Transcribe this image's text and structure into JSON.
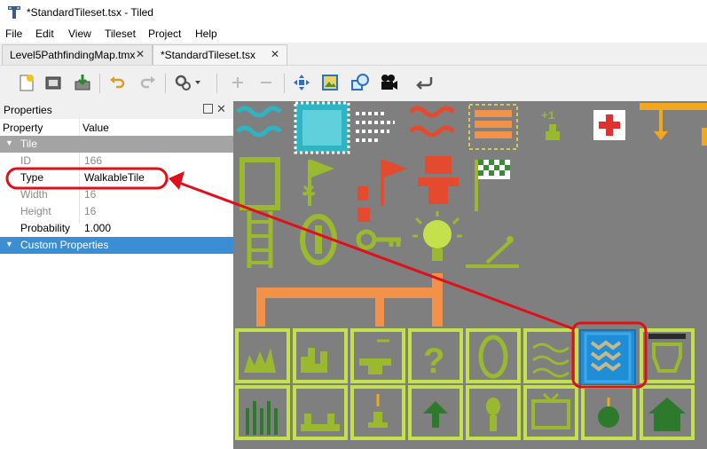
{
  "window": {
    "title": "*StandardTileset.tsx - Tiled"
  },
  "menu": [
    "File",
    "Edit",
    "View",
    "Tileset",
    "Project",
    "Help"
  ],
  "tabs": [
    {
      "label": "Level5PathfindingMap.tmx",
      "close": "✕"
    },
    {
      "label": "*StandardTileset.tsx",
      "close": "✕"
    }
  ],
  "toolbar": {
    "icons": [
      "new-file-icon",
      "open-icon",
      "save-icon",
      "undo-icon",
      "redo-icon",
      "settings-icon",
      "add-icon",
      "remove-icon",
      "move-icon",
      "image-icon",
      "shape-icon",
      "camera-icon",
      "back-arrow-icon"
    ]
  },
  "properties": {
    "title": "Properties",
    "close": "✕",
    "header": {
      "property": "Property",
      "value": "Value"
    },
    "group_tile": "Tile",
    "rows": [
      {
        "key": "ID",
        "value": "166"
      },
      {
        "key": "Type",
        "value": "WalkableTile"
      },
      {
        "key": "Width",
        "value": "16"
      },
      {
        "key": "Height",
        "value": "16"
      },
      {
        "key": "Probability",
        "value": "1.000"
      }
    ],
    "group_custom": "Custom Properties"
  },
  "colors": {
    "tile_green": "#9ab92e",
    "tile_bg": "#7f7f7f",
    "red_annotation": "#e0101a",
    "selection_blue": "#1f8ed6",
    "orange": "#f2924a"
  }
}
